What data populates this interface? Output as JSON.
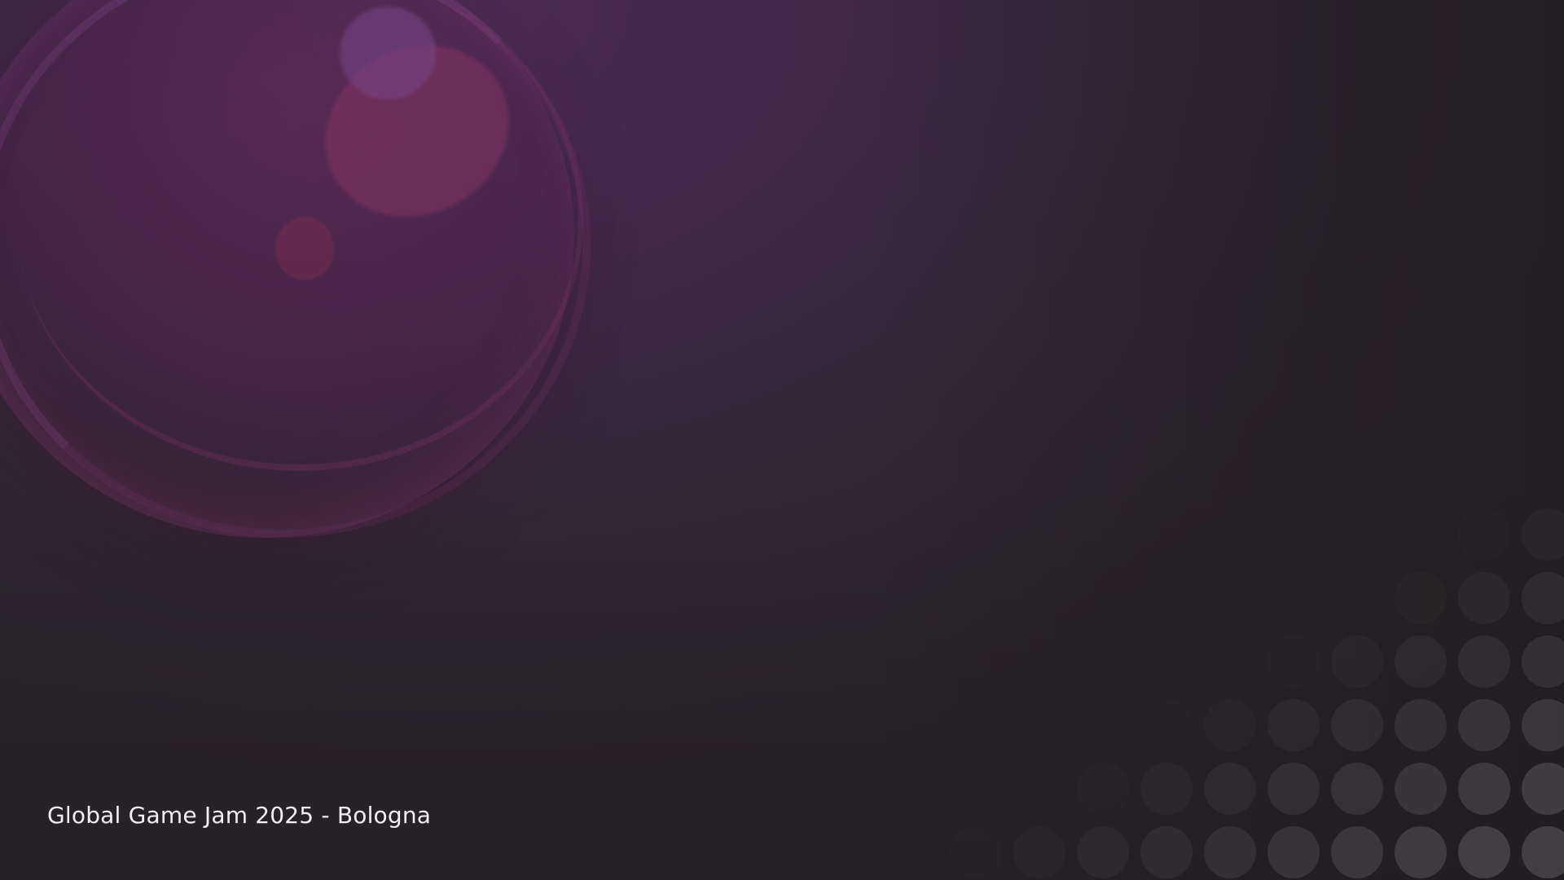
{
  "slide": {
    "footer_text": "Global Game Jam 2025 - Bologna"
  },
  "colors": {
    "background_top": "#4b2d52",
    "background_bottom": "#2a2529",
    "bubble_tint": "#6e285a",
    "dot_color": "#484548",
    "text_color": "#f2eef2"
  },
  "decorations": {
    "bubble_icon": "soap-bubble",
    "dot_pattern": "halftone-dots"
  }
}
